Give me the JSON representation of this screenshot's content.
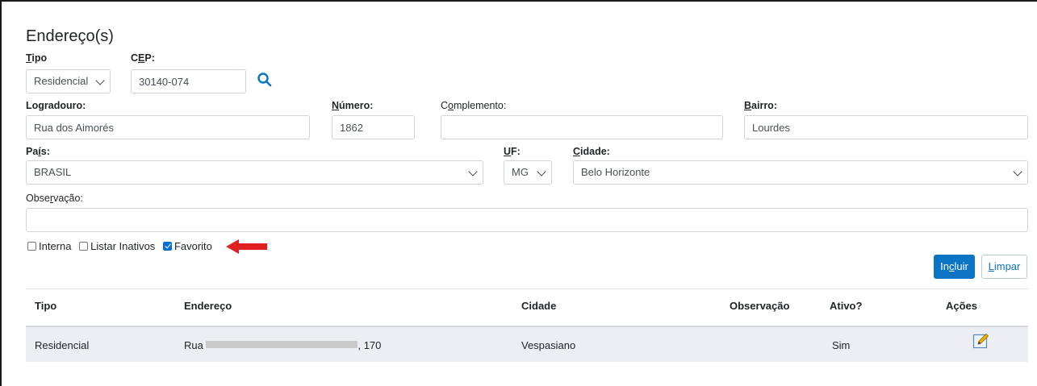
{
  "section": {
    "title": "Endereço(s)"
  },
  "labels": {
    "tipo": "Tipo",
    "cep": "CEP:",
    "logradouro": "Logradouro:",
    "numero": "Número:",
    "complemento": "Complemento:",
    "bairro": "Bairro:",
    "pais": "País:",
    "uf": "UF:",
    "cidade": "Cidade:",
    "observacao": "Observação:"
  },
  "fields": {
    "tipo": "Residencial",
    "cep": "30140-074",
    "logradouro": "Rua dos Aimorés",
    "numero": "1862",
    "complemento": "",
    "bairro": "Lourdes",
    "pais": "BRASIL",
    "uf": "MG",
    "cidade": "Belo Horizonte",
    "observacao": ""
  },
  "checkboxes": [
    {
      "label": "Interna",
      "checked": false
    },
    {
      "label": "Listar Inativos",
      "checked": false
    },
    {
      "label": "Favorito",
      "checked": true
    }
  ],
  "buttons": {
    "incluir": "Incluir",
    "limpar": "Limpar"
  },
  "table": {
    "headers": [
      "Tipo",
      "Endereço",
      "Cidade",
      "Observação",
      "Ativo?",
      "Ações"
    ],
    "rows": [
      {
        "tipo": "Residencial",
        "endereco_prefix": "Rua ",
        "endereco_suffix": ", 170",
        "cidade": "Vespasiano",
        "observacao": "",
        "ativo": "Sim"
      }
    ]
  },
  "colors": {
    "primary": "#0b74c4",
    "annotation_arrow": "#e02020",
    "checkbox_checked": "#0b6ed1"
  },
  "icons": [
    "search-icon",
    "chevron-down-icon",
    "edit-icon",
    "red-arrow-annotation"
  ]
}
